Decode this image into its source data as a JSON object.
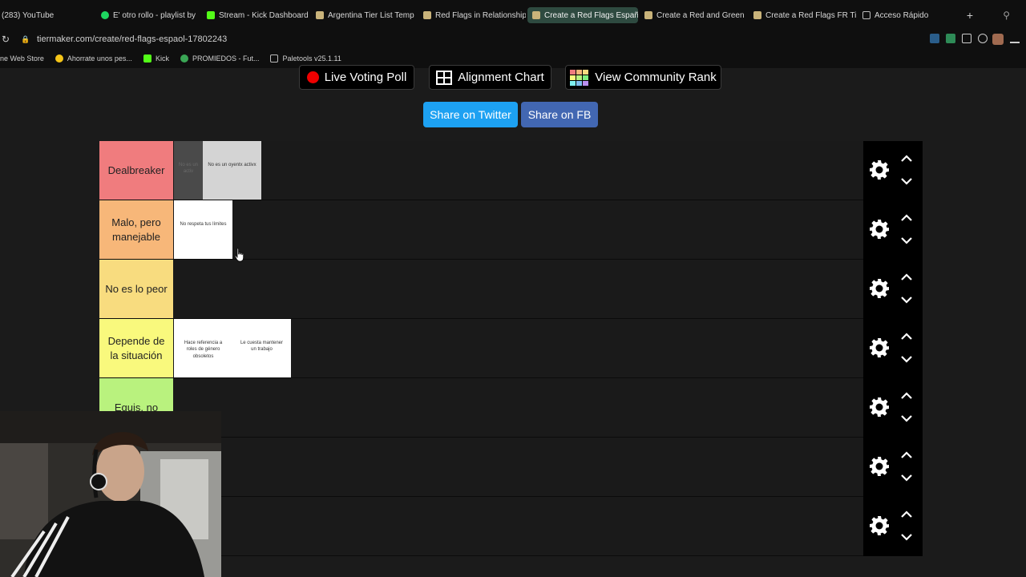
{
  "tabs": [
    {
      "label": "(283) YouTube",
      "color": "#d01e1e",
      "active": false
    },
    {
      "label": "E' otro rollo - playlist by",
      "color": "#1ed760",
      "active": false
    },
    {
      "label": "Stream - Kick Dashboard",
      "color": "#53fc18",
      "active": false
    },
    {
      "label": "Argentina Tier List Temp",
      "color": "#c9b37a",
      "active": false
    },
    {
      "label": "Red Flags in Relationship",
      "color": "#c9b37a",
      "active": false
    },
    {
      "label": "Create a Red Flags Españ",
      "color": "#c9b37a",
      "active": true
    },
    {
      "label": "Create a Red and Green",
      "color": "#c9b37a",
      "active": false
    },
    {
      "label": "Create a Red Flags FR Ti",
      "color": "#c9b37a",
      "active": false
    },
    {
      "label": "Acceso Rápido",
      "color": "#bbbbbb",
      "active": false
    }
  ],
  "address": {
    "url": "tiermaker.com/create/red-flags-espaol-17802243"
  },
  "bookmarks": [
    {
      "label": "ne Web Store",
      "color": "#4a90e2"
    },
    {
      "label": "Ahorrate unos pes...",
      "color": "#f5c518"
    },
    {
      "label": "Kick",
      "color": "#53fc18"
    },
    {
      "label": "PROMIEDOS - Fut...",
      "color": "#3aa655"
    },
    {
      "label": "Paletools v25.1.11",
      "color": "#bbbbbb"
    }
  ],
  "actions": {
    "live_poll": "Live Voting Poll",
    "alignment": "Alignment Chart",
    "community": "View Community Rank",
    "share_twitter": "Share on Twitter",
    "share_fb": "Share on FB"
  },
  "tiers": [
    {
      "label": "Dealbreaker",
      "color": "#f07c7e",
      "items": [
        "No es un oyentx activx"
      ],
      "ghost": "No es un activ"
    },
    {
      "label": "Malo, pero manejable",
      "color": "#f7b779",
      "items": [
        "No respeta tus límites"
      ]
    },
    {
      "label": "No es lo peor",
      "color": "#f8dc7f",
      "items": []
    },
    {
      "label": "Depende de la situación",
      "color": "#f9f97d",
      "items": [
        "Hace referencia a roles de género obsoletos",
        "Le cuesta mantener un trabajo"
      ]
    },
    {
      "label": "Equis, no",
      "color": "#b9f27e",
      "items": []
    },
    {
      "label": "",
      "color": "#7ef07f",
      "items": []
    },
    {
      "label": "",
      "color": "#7ff0f0",
      "items": []
    }
  ]
}
